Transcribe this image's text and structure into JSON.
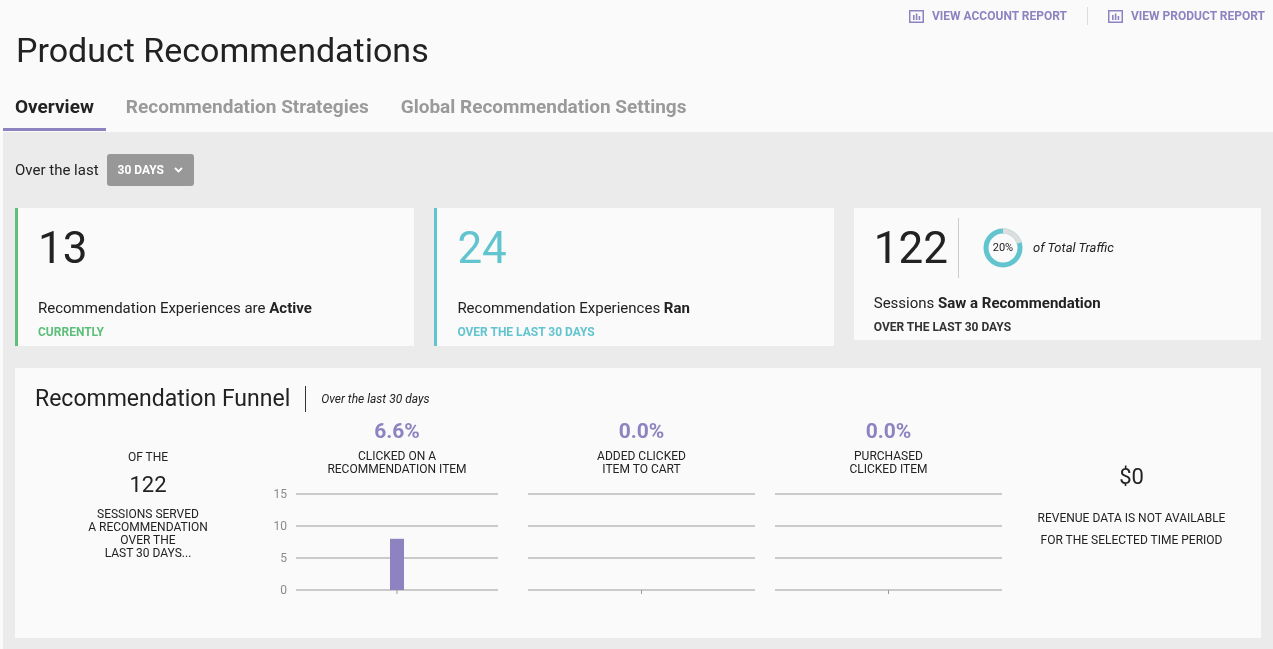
{
  "header_links": [
    {
      "label": "VIEW ACCOUNT REPORT"
    },
    {
      "label": "VIEW PRODUCT REPORT"
    }
  ],
  "title": "Product Recommendations",
  "tabs": [
    {
      "label": "Overview",
      "selected": true
    },
    {
      "label": "Recommendation Strategies",
      "selected": false
    },
    {
      "label": "Global Recommendation Settings",
      "selected": false
    }
  ],
  "period": {
    "label": "Over the last",
    "value": "30 DAYS"
  },
  "stat_cards": [
    {
      "value": "13",
      "text": "Recommendation Experiences are **Active**",
      "caption": "CURRENTLY",
      "color": "#5cbf7a"
    },
    {
      "value": "24",
      "text": "Recommendation Experiences **Ran**",
      "caption": "OVER THE LAST 30 DAYS",
      "color": "#62c4cf"
    }
  ],
  "sessions_card": {
    "value": "122",
    "share": {
      "label": "20%"
    },
    "share_text": "of Total Traffic",
    "text": "Sessions **Saw a Recommendation**",
    "caption": "OVER THE LAST 30 DAYS"
  },
  "funnel": {
    "title": "Recommendation Funnel",
    "subtitle": "Over the last 30 days",
    "intro": {
      "top": "OF THE",
      "value": "122",
      "lines": [
        "SESSIONS SERVED",
        "A RECOMMENDATION",
        "OVER THE",
        "LAST 30 DAYS..."
      ]
    },
    "steps": [
      {
        "value": "6.6%",
        "lines": [
          "CLICKED ON A",
          "RECOMMENDATION ITEM"
        ],
        "chart_data": {
          "type": "bar",
          "categories": [
            null
          ],
          "values": [
            8
          ],
          "ylim": [
            0,
            15
          ],
          "yticks": [
            0,
            5,
            10,
            15
          ]
        }
      },
      {
        "value": "0.0%",
        "lines": [
          "ADDED CLICKED",
          "ITEM TO CART"
        ]
      },
      {
        "value": "0.0%",
        "lines": [
          "PURCHASED",
          "CLICKED ITEM"
        ]
      }
    ],
    "revenue": {
      "value": "$0",
      "lines": [
        "REVENUE DATA IS NOT AVAILABLE",
        "FOR THE SELECTED TIME PERIOD"
      ]
    }
  }
}
